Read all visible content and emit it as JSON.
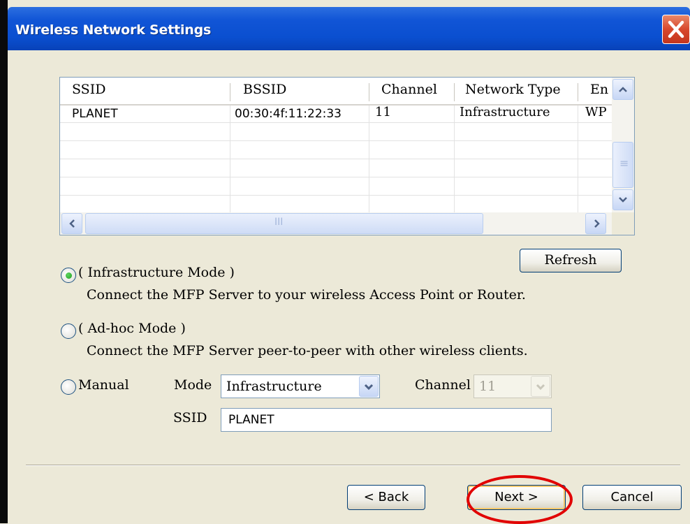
{
  "window": {
    "title": "Wireless Network Settings"
  },
  "network_list": {
    "columns": [
      "SSID",
      "BSSID",
      "Channel",
      "Network Type",
      "En"
    ],
    "rows": [
      {
        "ssid": "PLANET",
        "bssid": "00:30:4f:11:22:33",
        "channel": "11",
        "network_type": "Infrastructure",
        "encryption": "WP"
      }
    ],
    "hscroll_grip": "III",
    "vscroll_grip": "≡"
  },
  "refresh_button": {
    "label": "Refresh"
  },
  "modes": {
    "infrastructure": {
      "label": "( Infrastructure Mode )",
      "description": "Connect the MFP Server to your wireless Access Point or Router.",
      "selected": true
    },
    "adhoc": {
      "label": "( Ad-hoc Mode )",
      "description": "Connect the MFP Server peer-to-peer with other wireless clients.",
      "selected": false
    },
    "manual": {
      "label": "Manual",
      "selected": false
    }
  },
  "manual_settings": {
    "mode_label": "Mode",
    "mode_value": "Infrastructure",
    "channel_label": "Channel",
    "channel_value": "11",
    "ssid_label": "SSID",
    "ssid_value": "PLANET"
  },
  "footer": {
    "back_label": "< Back",
    "next_label": "Next >",
    "cancel_label": "Cancel"
  },
  "colors": {
    "titlebar": "#0a4fd0",
    "dialog_bg": "#ece9d8",
    "highlight": "#e10000",
    "radio_selected": "#21a121"
  }
}
